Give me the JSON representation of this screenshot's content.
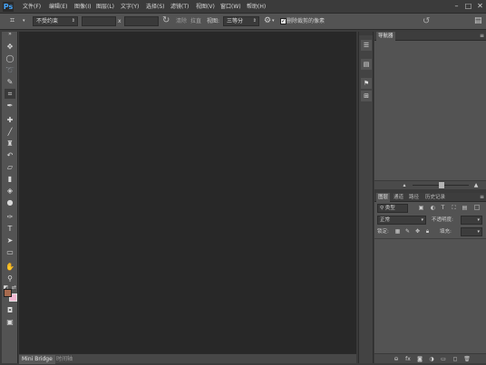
{
  "app": {
    "logo": "Ps"
  },
  "menu": [
    "文件(F)",
    "编辑(E)",
    "图像(I)",
    "图层(L)",
    "文字(Y)",
    "选择(S)",
    "滤镜(T)",
    "视图(V)",
    "窗口(W)",
    "帮助(H)"
  ],
  "window_controls": {
    "minimize": "–",
    "maximize": "□",
    "close": "✕"
  },
  "options": {
    "tool_icon": "crop-icon",
    "ratio_value": "不受约束",
    "times_sign": "x",
    "clear_label": "清除",
    "straighten_label": "拉直",
    "view_label": "视图:",
    "view_value": "三等分",
    "delete_cropped_label": "删除裁剪的像素"
  },
  "tools": [
    "move-icon",
    "marquee-icon",
    "lasso-icon",
    "quick-select-icon",
    "crop-icon",
    "eyedropper-icon",
    "healing-brush-icon",
    "brush-icon",
    "clone-stamp-icon",
    "history-brush-icon",
    "eraser-icon",
    "gradient-icon",
    "blur-icon",
    "dodge-icon",
    "pen-icon",
    "type-icon",
    "path-select-icon",
    "rectangle-icon",
    "hand-icon",
    "zoom-icon",
    "swap-colors-icon",
    "default-colors-icon",
    "quick-mask-icon",
    "screen-mode-icon"
  ],
  "colors": {
    "foreground": "#a66a4e",
    "background": "#f2b8d2",
    "canvas": "#282828",
    "panel": "#535353"
  },
  "bottom_tabs": [
    "Mini Bridge",
    "时间轴"
  ],
  "dock": [
    "history-icon",
    "properties-icon",
    "tool-presets-icon",
    "adjustments-icon"
  ],
  "navigator": {
    "tab": "导航器"
  },
  "layers": {
    "tabs": [
      "图层",
      "通道",
      "路径",
      "历史记录"
    ],
    "filter_kind": "类型",
    "blend_mode": "正常",
    "opacity_label": "不透明度:",
    "lock_label": "锁定:",
    "fill_label": "填充:"
  }
}
